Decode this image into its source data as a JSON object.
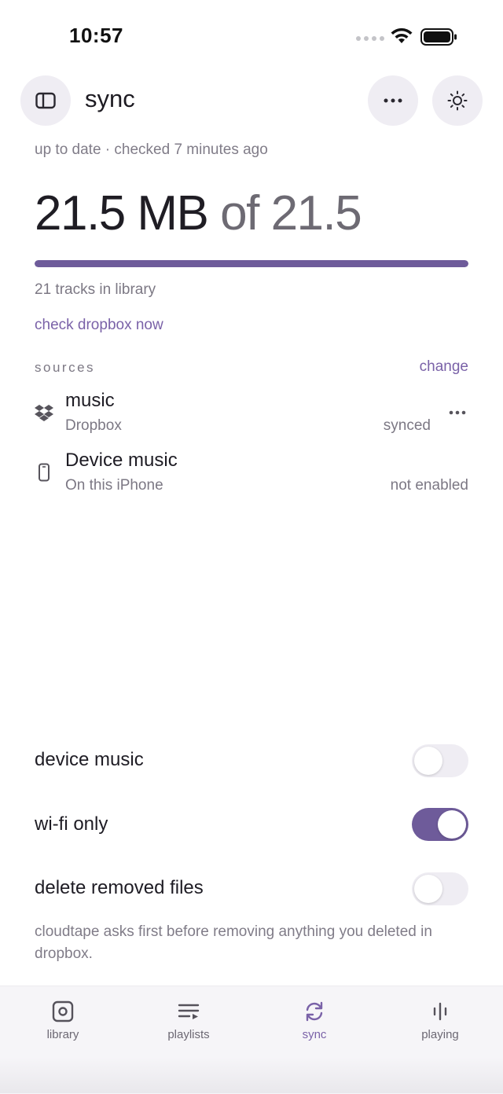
{
  "status_bar": {
    "time": "10:57"
  },
  "header": {
    "title": "sync"
  },
  "sync": {
    "status": "up to date · checked 7 minutes ago",
    "size_used": "21.5 MB",
    "size_total": "of 21.5",
    "progress_fraction": 1.0,
    "tracks": "21 tracks in library",
    "check_link": "check dropbox now"
  },
  "sources": {
    "label": "sources",
    "change_label": "change",
    "items": [
      {
        "name": "music",
        "provider": "Dropbox",
        "status": "synced",
        "icon": "dropbox-icon"
      },
      {
        "name": "Device music",
        "provider": "On this iPhone",
        "status": "not enabled",
        "icon": "phone-icon"
      }
    ]
  },
  "settings": {
    "device_music": {
      "label": "device music",
      "on": false
    },
    "wifi_only": {
      "label": "wi-fi only",
      "on": true
    },
    "delete_removed": {
      "label": "delete removed files",
      "on": false
    },
    "note": "cloudtape asks first before removing anything you deleted in dropbox."
  },
  "tabs": [
    {
      "label": "library",
      "icon": "library-icon",
      "active": false
    },
    {
      "label": "playlists",
      "icon": "playlists-icon",
      "active": false
    },
    {
      "label": "sync",
      "icon": "sync-icon",
      "active": true
    },
    {
      "label": "playing",
      "icon": "playing-icon",
      "active": false
    }
  ],
  "colors": {
    "accent": "#7a62a8",
    "accent_dark": "#6e5b9a",
    "button_bg": "#efedf3"
  }
}
